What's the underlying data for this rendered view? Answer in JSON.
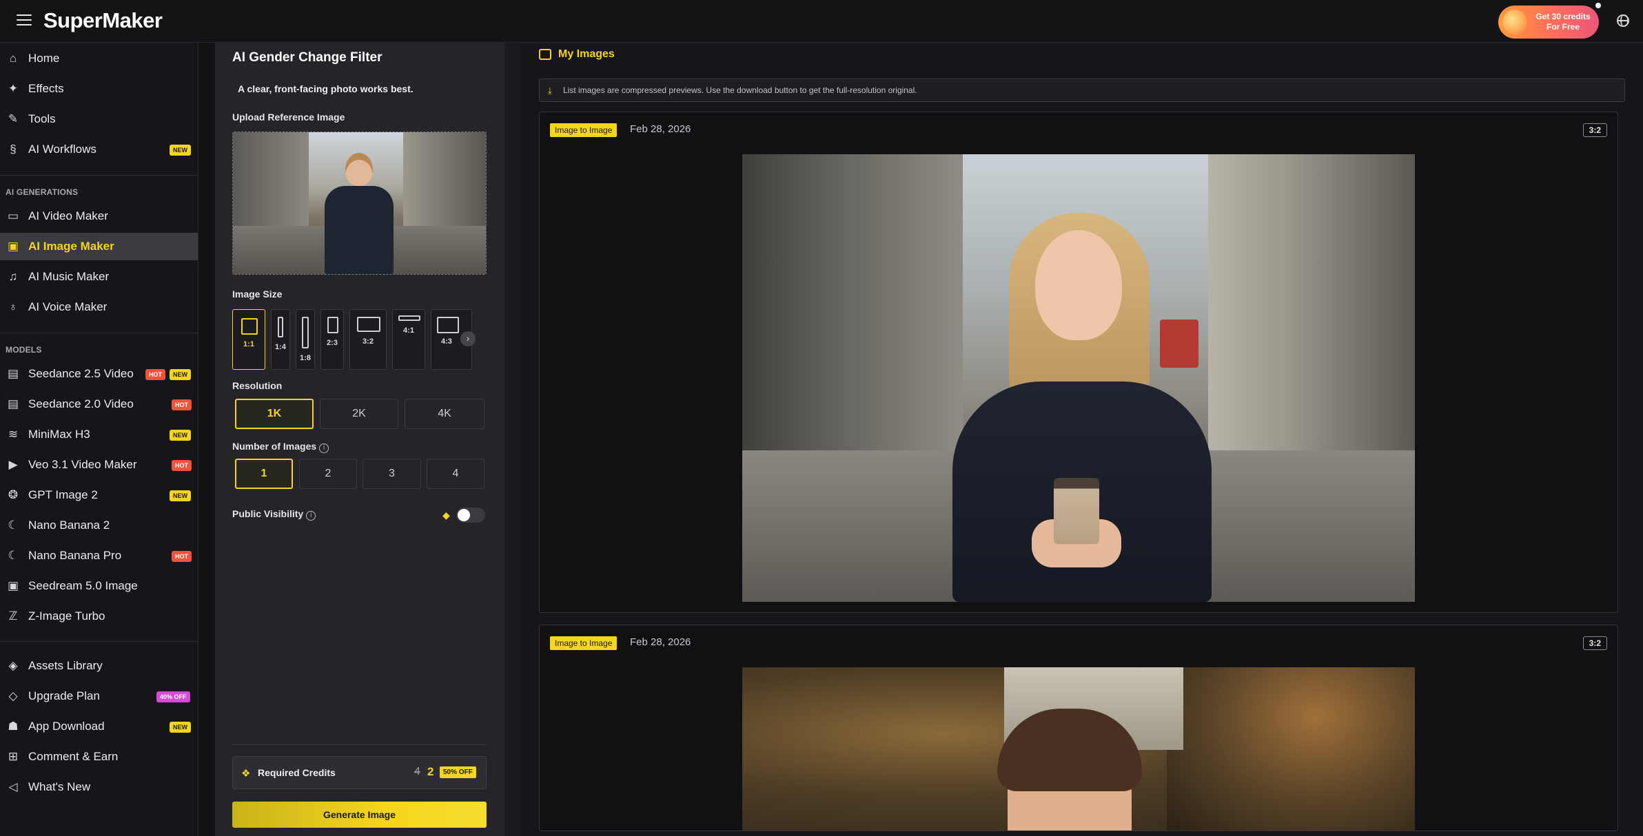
{
  "header": {
    "logo": "SuperMaker",
    "promo_text": "Get 30 credits For Free"
  },
  "sidebar": {
    "top_items": [
      {
        "label": "Home",
        "icon": "home-icon"
      },
      {
        "label": "Effects",
        "icon": "sparkle-icon"
      },
      {
        "label": "Tools",
        "icon": "wrench-icon"
      },
      {
        "label": "AI Workflows",
        "icon": "workflow-icon",
        "badge": "NEW"
      }
    ],
    "section_generations": "AI GENERATIONS",
    "generation_items": [
      {
        "label": "AI Video Maker",
        "icon": "video-icon"
      },
      {
        "label": "AI Image Maker",
        "icon": "image-icon",
        "active": true
      },
      {
        "label": "AI Music Maker",
        "icon": "music-icon"
      },
      {
        "label": "AI Voice Maker",
        "icon": "microphone-icon"
      }
    ],
    "section_models": "MODELS",
    "model_items": [
      {
        "label": "Seedance 2.5 Video",
        "icon": "clapper-icon",
        "badges": [
          "HOT",
          "NEW"
        ]
      },
      {
        "label": "Seedance 2.0 Video",
        "icon": "clapper-icon",
        "badges": [
          "HOT"
        ]
      },
      {
        "label": "MiniMax H3",
        "icon": "waveform-icon",
        "badges": [
          "NEW"
        ]
      },
      {
        "label": "Veo 3.1 Video Maker",
        "icon": "play-icon",
        "badges": [
          "HOT"
        ]
      },
      {
        "label": "GPT Image 2",
        "icon": "openai-icon",
        "badges": [
          "NEW"
        ]
      },
      {
        "label": "Nano Banana 2",
        "icon": "banana-icon",
        "badges": []
      },
      {
        "label": "Nano Banana Pro",
        "icon": "banana-icon",
        "badges": [
          "HOT"
        ]
      },
      {
        "label": "Seedream 5.0 Image",
        "icon": "image-icon",
        "badges": []
      },
      {
        "label": "Z-Image Turbo",
        "icon": "z-icon",
        "badges": []
      }
    ],
    "bottom_items": [
      {
        "label": "Assets Library",
        "icon": "layers-icon"
      },
      {
        "label": "Upgrade Plan",
        "icon": "diamond-icon",
        "badge": "40% OFF"
      },
      {
        "label": "App Download",
        "icon": "android-icon",
        "badge": "NEW"
      },
      {
        "label": "Comment & Earn",
        "icon": "gift-icon"
      },
      {
        "label": "What's New",
        "icon": "megaphone-icon"
      }
    ]
  },
  "panel": {
    "title": "AI Gender Change Filter",
    "hint": "A clear, front-facing photo works best.",
    "upload_label": "Upload Reference Image",
    "image_size_label": "Image Size",
    "sizes": [
      "1:1",
      "1:4",
      "1:8",
      "2:3",
      "3:2",
      "4:1",
      "4:3"
    ],
    "selected_size": "1:1",
    "resolution_label": "Resolution",
    "resolutions": [
      "1K",
      "2K",
      "4K"
    ],
    "selected_resolution": "1K",
    "count_label": "Number of Images",
    "counts": [
      "1",
      "2",
      "3",
      "4"
    ],
    "selected_count": "1",
    "visibility_label": "Public Visibility",
    "visibility_on": false,
    "credits_label": "Required Credits",
    "credits_old": "4",
    "credits_new": "2",
    "credits_discount": "50% OFF",
    "generate_label": "Generate Image"
  },
  "results": {
    "title": "My Images",
    "notice": "List images are compressed previews. Use the download button to get the full-resolution original.",
    "cards": [
      {
        "tag": "Image to Image",
        "date": "Feb 28, 2026",
        "ratio": "3:2"
      },
      {
        "tag": "Image to Image",
        "date": "Feb 28, 2026",
        "ratio": "3:2"
      }
    ]
  },
  "colors": {
    "accent": "#f5d51e",
    "hot": "#f0523c",
    "off": "#d44bd6",
    "background": "#111114"
  }
}
